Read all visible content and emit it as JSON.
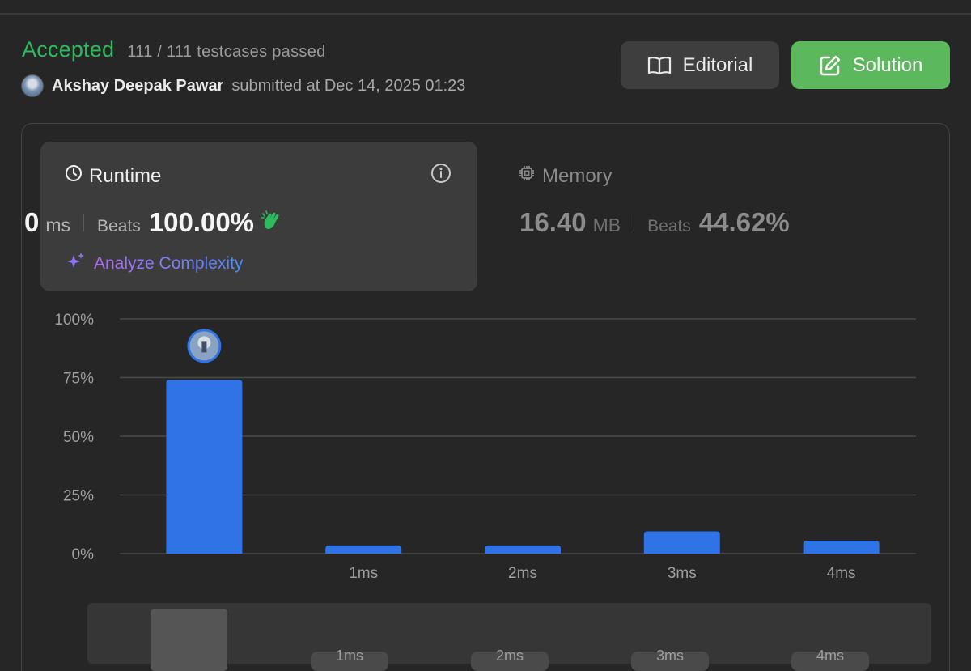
{
  "status": {
    "verdict": "Accepted",
    "testcases": "111 / 111 testcases passed"
  },
  "submission": {
    "user": "Akshay Deepak Pawar",
    "submitted": "submitted at Dec 14, 2025 01:23"
  },
  "buttons": {
    "editorial": "Editorial",
    "solution": "Solution"
  },
  "runtime": {
    "title": "Runtime",
    "value": "0",
    "unit": "ms",
    "beats_label": "Beats",
    "beats": "100.00%",
    "analyze": "Analyze Complexity"
  },
  "memory": {
    "title": "Memory",
    "value": "16.40",
    "unit": "MB",
    "beats_label": "Beats",
    "beats": "44.62%"
  },
  "colors": {
    "accepted": "#2cbb5d",
    "solution": "#5cb85c",
    "bar": "#2f73e6",
    "clap": "#2cbb5d"
  },
  "chart_data": {
    "type": "bar",
    "categories": [
      "",
      "1ms",
      "2ms",
      "3ms",
      "4ms"
    ],
    "values": [
      74,
      3.5,
      3.5,
      9.5,
      5.5
    ],
    "ylim": [
      0,
      100
    ],
    "yticks": [
      "0%",
      "25%",
      "50%",
      "75%",
      "100%"
    ],
    "ytick_values": [
      0,
      25,
      50,
      75,
      100
    ],
    "grid": true,
    "highlight_index": 0
  },
  "mini_chart": {
    "labels": [
      "1ms",
      "2ms",
      "3ms",
      "4ms"
    ]
  }
}
